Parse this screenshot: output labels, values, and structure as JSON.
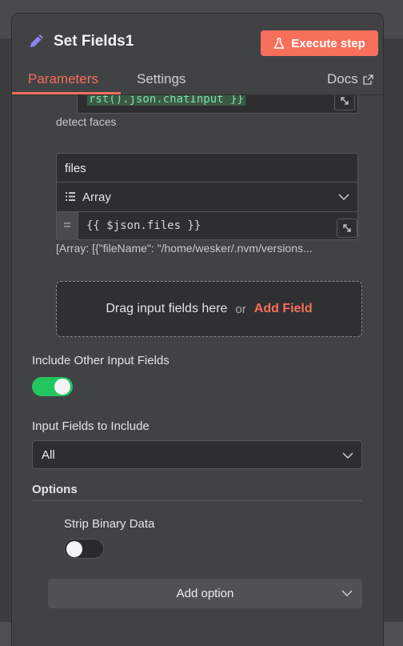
{
  "header": {
    "title": "Set Fields1",
    "execute_label": "Execute step",
    "tabs": {
      "parameters": "Parameters",
      "settings": "Settings",
      "docs": "Docs"
    },
    "active_tab": "Parameters"
  },
  "fields": {
    "prev_expression": "rst().json.chatInput }}",
    "prev_hint": "detect faces",
    "field": {
      "name": "files",
      "type": "Array",
      "value": "{{ $json.files }}",
      "preview": "[Array: [{\"fileName\": \"/home/wesker/.nvm/versions..."
    }
  },
  "dropzone": {
    "text": "Drag input fields here",
    "or": "or",
    "add_field": "Add Field"
  },
  "include_other": {
    "label": "Include Other Input Fields",
    "enabled": true
  },
  "input_fields_to_include": {
    "label": "Input Fields to Include",
    "value": "All"
  },
  "options": {
    "heading": "Options",
    "strip_binary": {
      "label": "Strip Binary Data",
      "enabled": false
    },
    "add_option_label": "Add option"
  },
  "colors": {
    "accent": "#f6705b",
    "toggle_on": "#22c55e",
    "panel": "#414244"
  }
}
